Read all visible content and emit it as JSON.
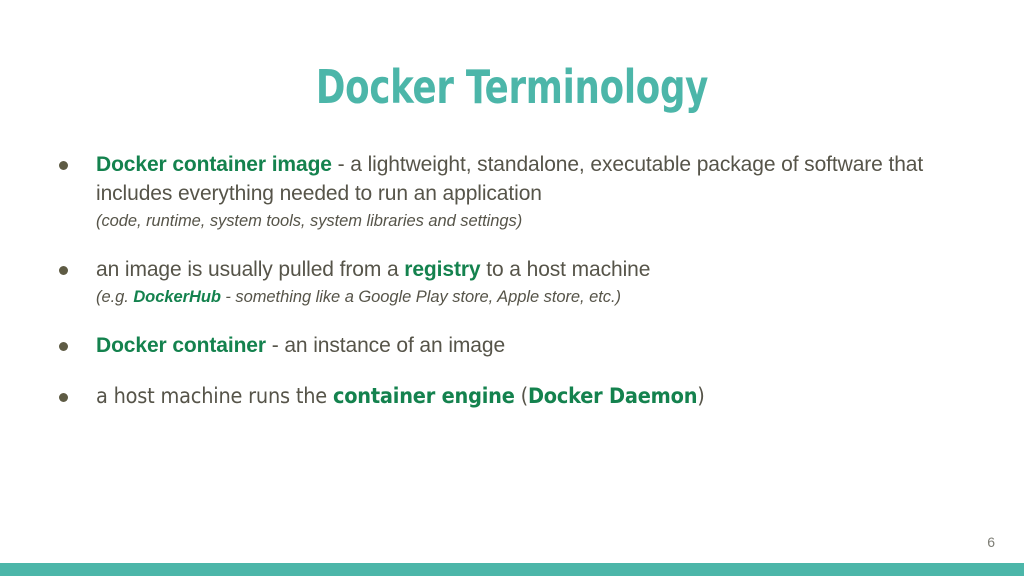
{
  "slide": {
    "title": "Docker Terminology",
    "page_number": "6",
    "colors": {
      "title_teal": "#4cb6a9",
      "accent_green": "#14824e",
      "body_gray": "#565449",
      "bullet_dot": "#5e5b44",
      "footer_bar": "#4cb6a9",
      "background": "#ffffff"
    }
  },
  "bullets": [
    {
      "term": "Docker container image",
      "dash": " - ",
      "main_rest": "a lightweight, standalone, executable package of software that includes everything needed to run an application",
      "sub": "(code, runtime, system tools, system libraries and settings)"
    },
    {
      "lead": "an image is usually pulled from a ",
      "term": "registry",
      "trail": " to a host machine",
      "sub_open": "(e.g. ",
      "sub_term": "DockerHub",
      "sub_rest": " - something like a Google Play store, Apple store, etc.)"
    },
    {
      "term": "Docker container",
      "dash": " - ",
      "main_rest": "an instance of an image"
    },
    {
      "lead": "a host machine runs the ",
      "term": "container engine",
      "mid": " (",
      "term2": "Docker Daemon",
      "close": ")"
    }
  ]
}
